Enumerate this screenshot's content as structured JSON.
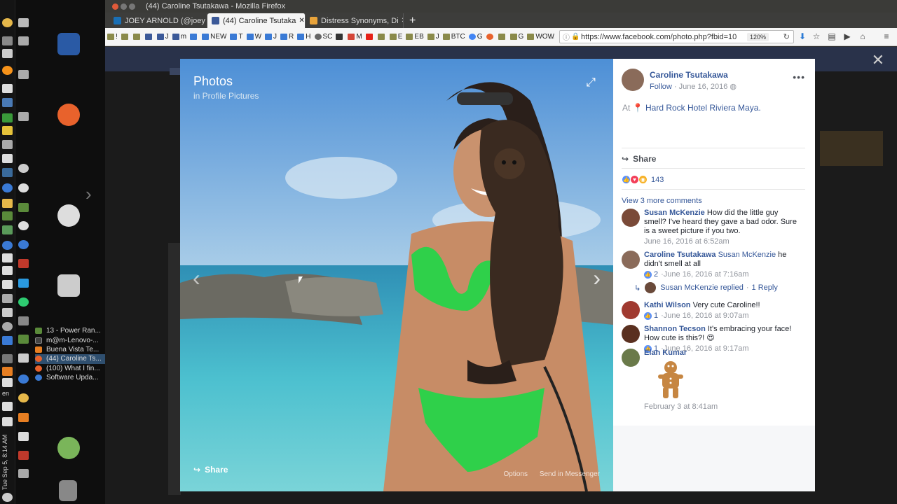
{
  "os_taskbar": {
    "window_list": [
      {
        "label": "13 - Power Ran...",
        "color": "#5a8a3a"
      },
      {
        "label": "m@m-Lenovo-...",
        "color": "#444"
      },
      {
        "label": "Buena Vista Te...",
        "color": "#e67e22"
      },
      {
        "label": "(44) Caroline Ts...",
        "color": "#e8622c"
      },
      {
        "label": "(100) What I fin...",
        "color": "#e8622c"
      },
      {
        "label": "Software Upda...",
        "color": "#3a7ad5"
      }
    ],
    "clock": "Tue Sep 5, 8:14 AM",
    "language": "en"
  },
  "window": {
    "title": "(44) Caroline Tsutakawa - Mozilla Firefox"
  },
  "tabs": [
    {
      "label": "JOEY ARNOLD (@joey",
      "icon_color": "#1a6fb5"
    },
    {
      "label": "(44) Caroline Tsutaka",
      "icon_color": "#3b5998"
    },
    {
      "label": "Distress Synonyms, Di",
      "icon_color": "#e8a33a"
    }
  ],
  "bookmarks": [
    "!",
    "",
    "",
    "",
    "J",
    "m",
    "",
    "NEW",
    "T",
    "W",
    "J",
    "R",
    "H",
    "SC",
    "",
    "M",
    "",
    "",
    "E",
    "EB",
    "J",
    "BTC",
    "G",
    "",
    "",
    "G",
    "WOW"
  ],
  "nav": {
    "url": "https://www.facebook.com/photo.php?fbid=10",
    "zoom": "120%"
  },
  "photo": {
    "title": "Photos",
    "subtitle": "in Profile Pictures",
    "share_label": "Share",
    "options_label": "Options",
    "send_label": "Send in Messenger"
  },
  "post": {
    "author": "Caroline Tsutakawa",
    "follow_label": "Follow",
    "date": "June 16, 2016",
    "location_prefix": "At",
    "location": "Hard Rock Hotel Riviera Maya.",
    "share_label": "Share",
    "reaction_count": "143",
    "view_more": "View 3 more comments"
  },
  "comments": [
    {
      "name": "Susan McKenzie",
      "tag": "",
      "text": "How did the little guy smell? I've heard they gave a bad odor. Sure is a sweet picture if you two.",
      "likes": "",
      "time": "June 16, 2016 at 6:52am",
      "avatar_color": "#7a4a38"
    },
    {
      "name": "Caroline Tsutakawa",
      "tag": "Susan McKenzie",
      "text": "he didn't smell at all",
      "likes": "2",
      "time": "June 16, 2016 at 7:16am",
      "avatar_color": "#8a6b5a"
    },
    {
      "name": "Kathi Wilson",
      "tag": "",
      "text": "Very cute Caroline!!",
      "likes": "1",
      "time": "June 16, 2016 at 9:07am",
      "avatar_color": "#a03a30"
    },
    {
      "name": "Shannon Tecson",
      "tag": "",
      "text": "It's embracing your face! How cute is this?! 😍",
      "likes": "1",
      "time": "June 16, 2016 at 9:17am",
      "avatar_color": "#5a3020"
    },
    {
      "name": "Elan Kumar",
      "tag": "",
      "text": "",
      "likes": "",
      "time": "February 3 at 8:41am",
      "avatar_color": "#6a7a4a"
    }
  ],
  "reply": {
    "author": "Susan McKenzie replied",
    "separator": "·",
    "count_label": "1 Reply"
  }
}
